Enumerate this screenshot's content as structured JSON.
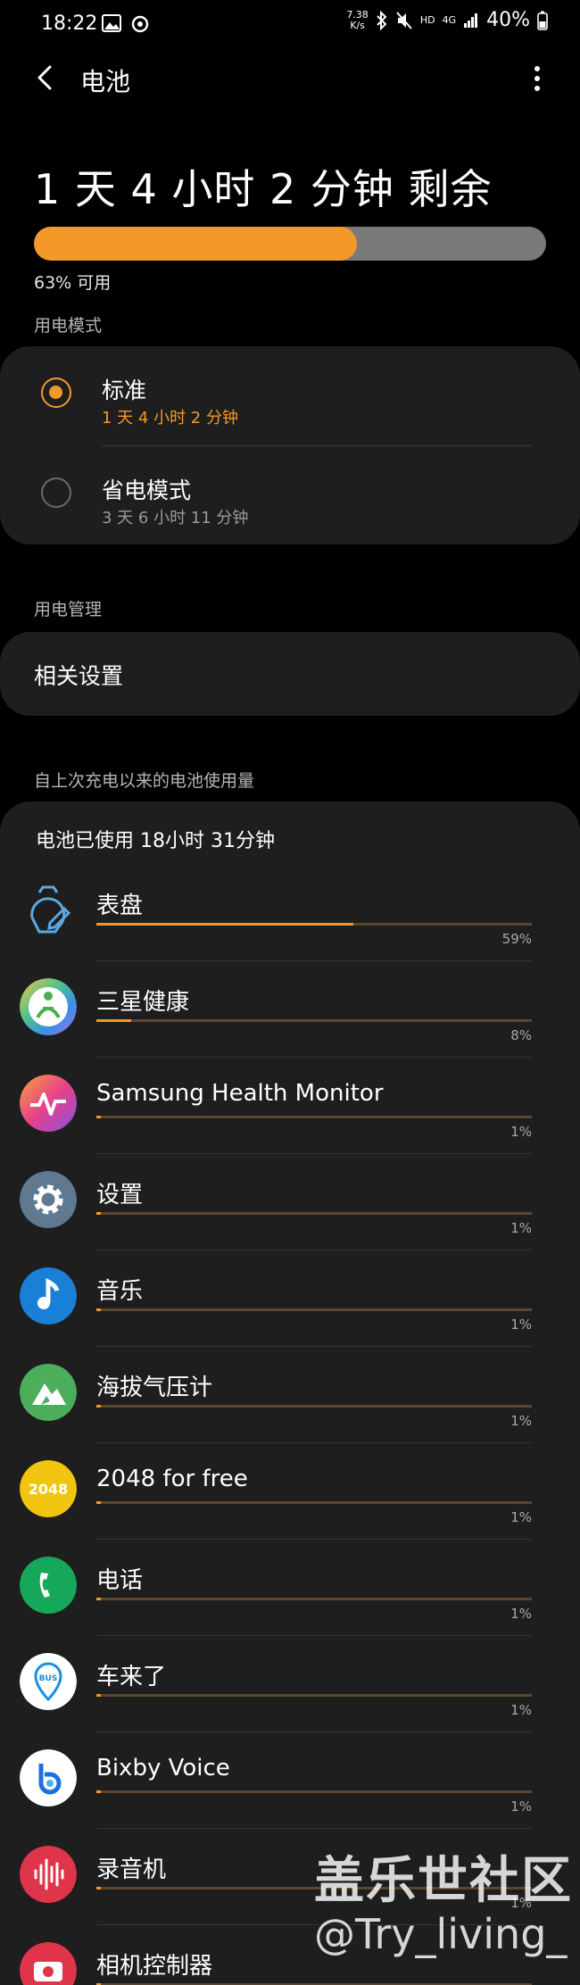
{
  "status_bar": {
    "time": "18:22",
    "net_speed_top": "7.38",
    "net_speed_bottom": "K/s",
    "hd": "HD",
    "network": "4G",
    "battery_percent": "40%"
  },
  "header": {
    "title": "电池"
  },
  "battery": {
    "remaining_text": "1 天 4 小时 2 分钟 剩余",
    "level_percent": 63,
    "available_text": "63% 可用",
    "fill_color": "#f2992a"
  },
  "power_mode": {
    "section_label": "用电模式",
    "modes": [
      {
        "name": "标准",
        "time": "1 天 4 小时 2 分钟",
        "selected": true
      },
      {
        "name": "省电模式",
        "time": "3 天 6 小时 11 分钟",
        "selected": false
      }
    ]
  },
  "power_management": {
    "section_label": "用电管理",
    "related_settings": "相关设置"
  },
  "usage": {
    "section_label": "自上次充电以来的电池使用量",
    "summary": "电池已使用 18小时 31分钟",
    "apps": [
      {
        "name": "表盘",
        "percent_text": "59%",
        "percent": 59,
        "icon": "watch-face-icon"
      },
      {
        "name": "三星健康",
        "percent_text": "8%",
        "percent": 8,
        "icon": "samsung-health-icon"
      },
      {
        "name": "Samsung Health Monitor",
        "percent_text": "1%",
        "percent": 1,
        "icon": "health-monitor-icon"
      },
      {
        "name": "设置",
        "percent_text": "1%",
        "percent": 1,
        "icon": "settings-gear-icon"
      },
      {
        "name": "音乐",
        "percent_text": "1%",
        "percent": 1,
        "icon": "music-note-icon"
      },
      {
        "name": "海拔气压计",
        "percent_text": "1%",
        "percent": 1,
        "icon": "barometer-icon"
      },
      {
        "name": "2048 for free",
        "percent_text": "1%",
        "percent": 1,
        "icon": "game-2048-icon",
        "icon_label": "2048"
      },
      {
        "name": "电话",
        "percent_text": "1%",
        "percent": 1,
        "icon": "phone-icon"
      },
      {
        "name": "车来了",
        "percent_text": "1%",
        "percent": 1,
        "icon": "bus-icon",
        "icon_label": "BUS"
      },
      {
        "name": "Bixby Voice",
        "percent_text": "1%",
        "percent": 1,
        "icon": "bixby-icon"
      },
      {
        "name": "录音机",
        "percent_text": "1%",
        "percent": 1,
        "icon": "voice-recorder-icon"
      },
      {
        "name": "相机控制器",
        "percent_text": "",
        "percent": 1,
        "icon": "camera-controller-icon"
      }
    ]
  },
  "watermark": {
    "line1": "盖乐世社区",
    "line2": "@Try_living_"
  }
}
